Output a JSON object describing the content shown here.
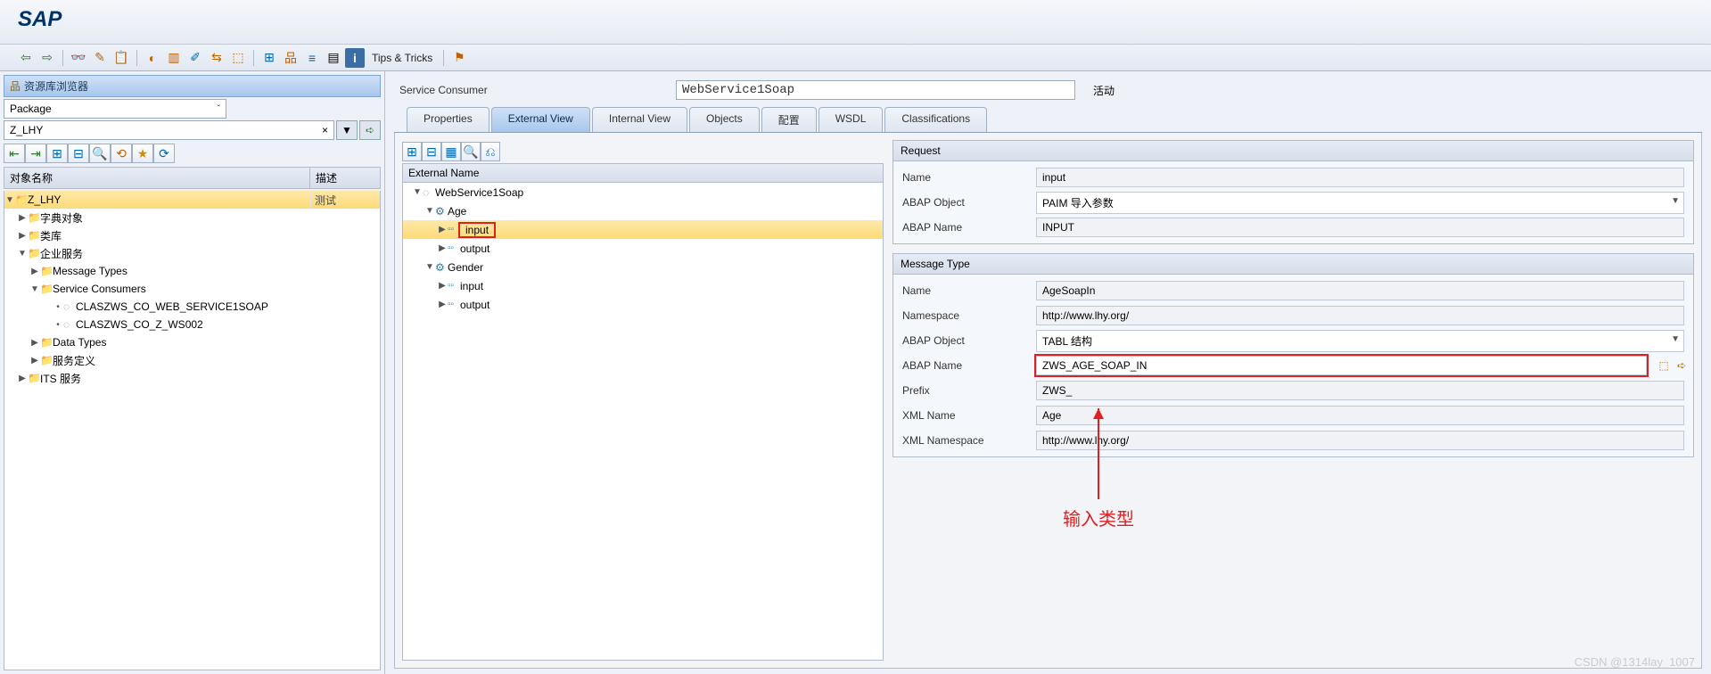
{
  "app_title": "SAP",
  "toolbar_tips": "Tips & Tricks",
  "left": {
    "browser_title": "资源库浏览器",
    "dd1": "Package",
    "dd2": "Z_LHY",
    "col_name": "对象名称",
    "col_desc": "描述",
    "tree": {
      "root": "Z_LHY",
      "root_desc": "测试",
      "n_dict": "字典对象",
      "n_lib": "类库",
      "n_ent": "企业服务",
      "n_msg": "Message Types",
      "n_sc": "Service Consumers",
      "sc1": "CLASZWS_CO_WEB_SERVICE1SOAP",
      "sc2": "CLASZWS_CO_Z_WS002",
      "n_dt": "Data Types",
      "n_sd": "服务定义",
      "n_its": "ITS 服务"
    }
  },
  "main": {
    "svc_label": "Service Consumer",
    "svc_value": "WebService1Soap",
    "svc_status": "活动",
    "tabs": {
      "properties": "Properties",
      "external": "External View",
      "internal": "Internal View",
      "objects": "Objects",
      "config": "配置",
      "wsdl": "WSDL",
      "class": "Classifications"
    },
    "ext_name_head": "External Name",
    "ext_tree": {
      "root": "WebService1Soap",
      "age": "Age",
      "input": "input",
      "output": "output",
      "gender": "Gender"
    },
    "request": {
      "title": "Request",
      "name_l": "Name",
      "name_v": "input",
      "ao_l": "ABAP Object",
      "ao_v": "PAIM 导入参数",
      "an_l": "ABAP Name",
      "an_v": "INPUT"
    },
    "msgtype": {
      "title": "Message Type",
      "name_l": "Name",
      "name_v": "AgeSoapIn",
      "ns_l": "Namespace",
      "ns_v": "http://www.lhy.org/",
      "ao_l": "ABAP Object",
      "ao_v": "TABL 结构",
      "an_l": "ABAP Name",
      "an_v": "ZWS_AGE_SOAP_IN",
      "pre_l": "Prefix",
      "pre_v": "ZWS_",
      "xml_l": "XML Name",
      "xml_v": "Age",
      "xmlns_l": "XML Namespace",
      "xmlns_v": "http://www.lhy.org/"
    }
  },
  "annotation": "输入类型",
  "watermark": "CSDN @1314lay_1007"
}
